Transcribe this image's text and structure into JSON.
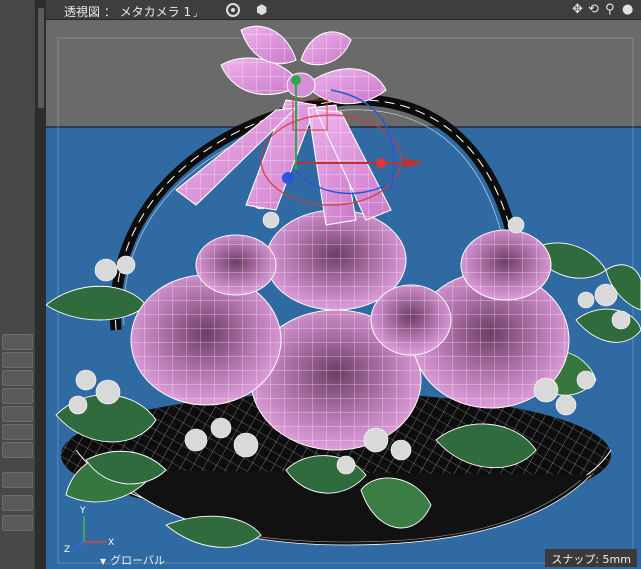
{
  "viewport": {
    "title": "透視図 ： メタカメラ 1",
    "title_suffix": "⌟",
    "coord_system": "グローバル",
    "snap_label": "スナップ: 5mm"
  },
  "axes": {
    "x": "X",
    "y": "Y",
    "z": "Z"
  },
  "colors": {
    "background": "#2f6aa2",
    "floor": "#5e5e5e",
    "ribbon": "#e79ae6",
    "rose": "#c988c5",
    "leaf": "#2f6b3c",
    "basket": "#111111",
    "wire": "#ffffff"
  }
}
